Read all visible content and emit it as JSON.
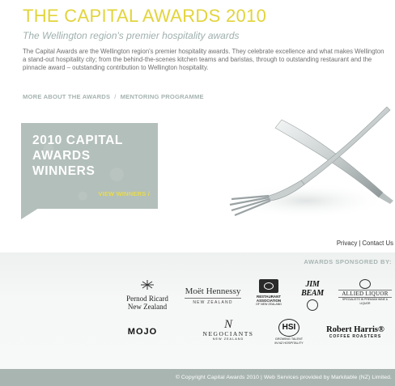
{
  "header": {
    "title": "THE CAPITAL AWARDS 2010",
    "subtitle": "The Wellington region's premier hospitality awards",
    "intro": "The Capital Awards are the Wellington region's premier hospitality awards. They celebrate excellence and what makes Wellington a stand-out hospitality city; from the behind-the-scenes kitchen teams and baristas, through to outstanding restaurant and the pinnacle award – outstanding contribution to Wellington hospitality."
  },
  "nav": {
    "more_about": "MORE ABOUT THE AWARDS",
    "separator": "/",
    "mentoring": "MENTORING PROGRAMME"
  },
  "winners_panel": {
    "line1": "2010 CAPITAL",
    "line2": "AWARDS",
    "line3": "WINNERS",
    "view_link": "VIEW WINNERS /"
  },
  "footer_links": {
    "privacy": "Privacy",
    "separator": "|",
    "contact": "Contact Us"
  },
  "sponsors": {
    "heading": "AWARDS SPONSORED BY:",
    "pernod_line1": "Pernod Ricard",
    "pernod_line2": "New Zealand",
    "moet_line1": "Moët Hennessy",
    "moet_line2": "NEW ZEALAND",
    "restaurant_assoc_line1": "RESTAURANT",
    "restaurant_assoc_line2": "ASSOCIATION",
    "restaurant_assoc_line3": "OF NEW ZEALAND",
    "jimbeam": "JIM BEAM",
    "allied_line1": "ALLIED LIQUOR",
    "allied_line2": "SPECIALISTS IN PREMIUM WINE & LIQUOR",
    "mojo": "MOJO",
    "negociants_line1": "NEGOCIANTS",
    "negociants_line2": "NEW ZEALAND",
    "hsi_line1": "HSI",
    "hsi_line2": "GROWING TALENT",
    "hsi_line3": "IN NZ HOSPITALITY",
    "robert_harris_line1": "Robert Harris®",
    "robert_harris_line2": "COFFEE ROASTERS"
  },
  "copyright": "© Copyright Capital Awards 2010 | Web Services provided by Markitable (NZ) Limited."
}
